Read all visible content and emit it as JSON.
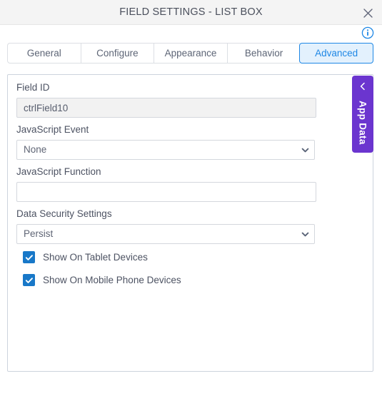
{
  "dialog": {
    "title": "FIELD SETTINGS - LIST BOX",
    "close_icon": "close-icon",
    "info_icon": "info-icon"
  },
  "tabs": [
    {
      "label": "General",
      "active": false
    },
    {
      "label": "Configure",
      "active": false
    },
    {
      "label": "Appearance",
      "active": false
    },
    {
      "label": "Behavior",
      "active": false
    },
    {
      "label": "Advanced",
      "active": true
    }
  ],
  "form": {
    "field_id": {
      "label": "Field ID",
      "value": "ctrlField10",
      "placeholder": "",
      "readonly": true
    },
    "javascript_event": {
      "label": "JavaScript Event",
      "value": "None",
      "options": [
        "None"
      ]
    },
    "javascript_function": {
      "label": "JavaScript Function",
      "value": "",
      "placeholder": ""
    },
    "data_security_settings": {
      "label": "Data Security Settings",
      "value": "Persist",
      "options": [
        "Persist"
      ]
    },
    "checkboxes": [
      {
        "label": "Show On Tablet Devices",
        "checked": true
      },
      {
        "label": "Show On Mobile Phone Devices",
        "checked": true
      }
    ]
  },
  "app_data_tab": {
    "label": "App Data",
    "chevron_icon": "chevron-left-icon"
  },
  "colors": {
    "accent_blue": "#1e87e5",
    "checkbox_blue": "#1878c8",
    "app_data_purple": "#6b35cf",
    "titlebar_bg": "#f4f4f4",
    "panel_border": "#ccd3dd",
    "readonly_bg": "#f2f2f2",
    "active_tab_bg": "#e3f1fd"
  }
}
